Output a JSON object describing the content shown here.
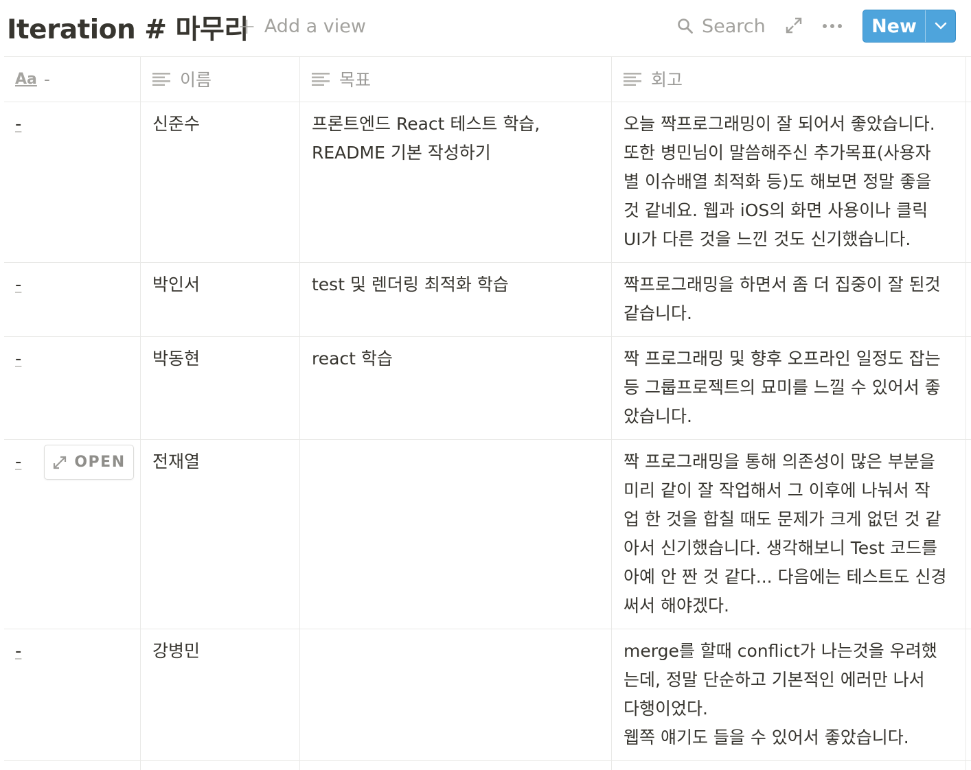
{
  "header": {
    "title": "Iteration # 마무리",
    "add_view_label": "Add a view",
    "search_label": "Search",
    "new_label": "New"
  },
  "columns": [
    {
      "label": "-",
      "icon": "title-aa-icon"
    },
    {
      "label": "이름",
      "icon": "text-lines-icon"
    },
    {
      "label": "목표",
      "icon": "text-lines-icon"
    },
    {
      "label": "회고",
      "icon": "text-lines-icon"
    }
  ],
  "rows": [
    {
      "title": "-",
      "name": "신준수",
      "goal": "프론트엔드 React 테스트 학습,\nREADME 기본 작성하기",
      "retro": "오늘 짝프로그래밍이 잘 되어서 좋았습니다.\n또한 병민님이 말씀해주신 추가목표(사용자\n별 이슈배열 최적화 등)도 해보면 정말 좋을\n것 같네요. 웹과 iOS의 화면 사용이나 클릭\nUI가 다른 것을 느낀 것도 신기했습니다."
    },
    {
      "title": "-",
      "name": "박인서",
      "goal": "test 및 렌더링 최적화 학습",
      "retro": "짝프로그래밍을 하면서 좀 더 집중이 잘 된것\n같습니다."
    },
    {
      "title": "-",
      "name": "박동현",
      "goal": "react 학습",
      "retro": "짝 프로그래밍 및 향후 오프라인 일정도 잡는\n등 그룹프로젝트의 묘미를 느낄 수 있어서 좋\n았습니다."
    },
    {
      "title": "-",
      "name": "전재열",
      "goal": "",
      "retro": "짝 프로그래밍을 통해 의존성이 많은 부분을\n미리 같이 잘 작업해서 그 이후에 나눠서 작\n업 한 것을 합칠 때도 문제가 크게 없던 것 같\n아서 신기했습니다. 생각해보니 Test 코드를\n아예 안 짠 것 같다... 다음에는 테스트도 신경\n써서 해야겠다."
    },
    {
      "title": "-",
      "name": "강병민",
      "goal": "",
      "retro": "merge를 할때 conflict가 나는것을 우려했\n는데, 정말 단순하고 기본적인 에러만 나서\n다행이었다.\n웹쪽 얘기도 들을 수 있어서 좋았습니다."
    }
  ],
  "open_button_label": "OPEN"
}
